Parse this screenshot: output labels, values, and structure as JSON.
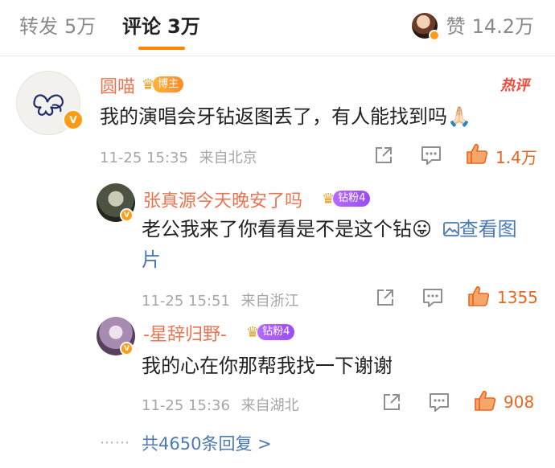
{
  "tabs": {
    "repost": {
      "label": "转发",
      "count": "5万"
    },
    "comment": {
      "label": "评论",
      "count": "3万"
    },
    "likes": {
      "label": "赞",
      "count": "14.2万"
    }
  },
  "colors": {
    "accent": "#ff8200",
    "username": "#eb7350",
    "link": "#4a79b5",
    "like": "#e8661e"
  },
  "comments": [
    {
      "username": "圆喵",
      "badge": "博主",
      "hot_tag": "热评",
      "text": "我的演唱会牙钻返图丢了，有人能找到吗",
      "emoji": "🙏🏻",
      "timestamp": "11-25 15:35",
      "location": "来自北京",
      "likes": "1.4万"
    },
    {
      "username": "张真源今天晚安了吗",
      "badge": "钻粉4",
      "text_part1": "老公我来了你看看是不是这个钻",
      "emoji": "😛",
      "link_icon": "image-icon",
      "link_text_1": "查看",
      "link_text_2": "图片",
      "timestamp": "11-25 15:51",
      "location": "来自浙江",
      "likes": "1355"
    },
    {
      "username": "-星辞归野-",
      "badge": "钻粉4",
      "text": "我的心在你那帮我找一下谢谢",
      "timestamp": "11-25 15:36",
      "location": "来自湖北",
      "likes": "908"
    }
  ],
  "more_replies": "共4650条回复 >",
  "dots": "⋯⋯"
}
